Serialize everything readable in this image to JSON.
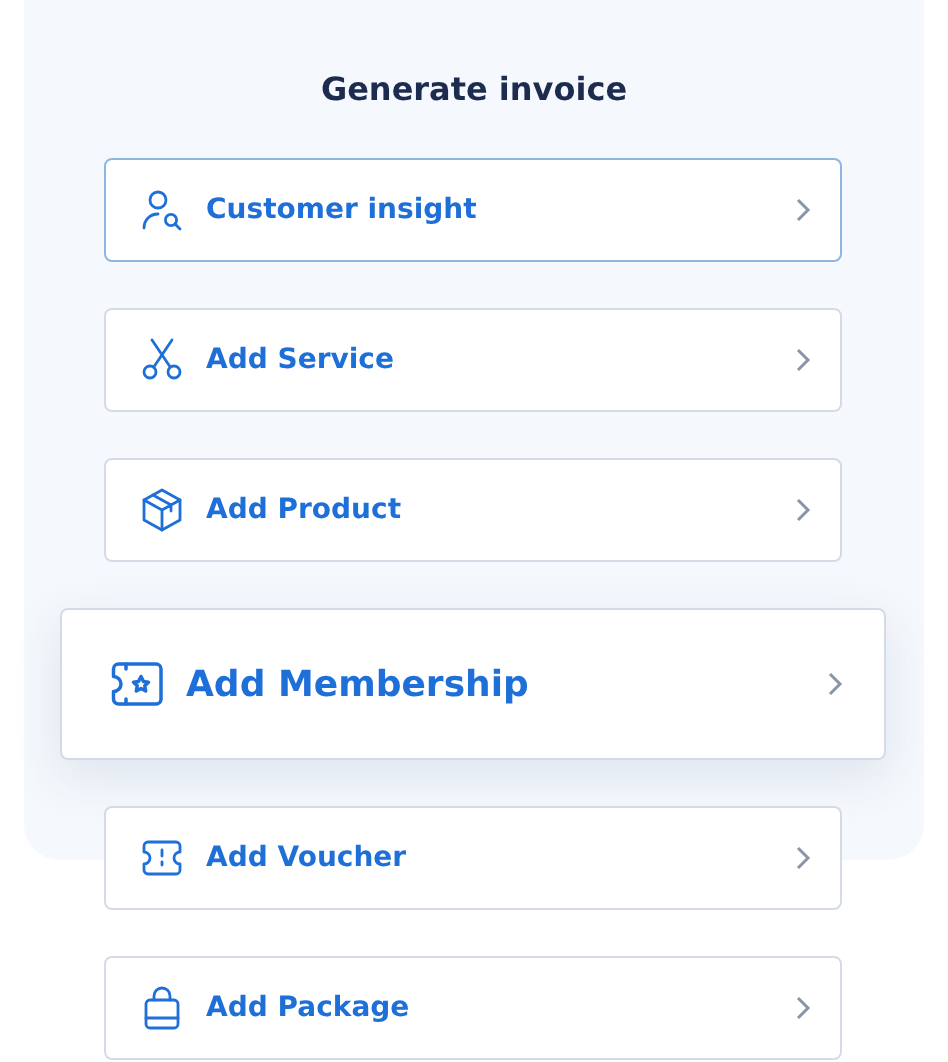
{
  "title": "Generate invoice",
  "items": [
    {
      "label": "Customer insight",
      "kind": "normal",
      "selected": true
    },
    {
      "label": "Add Service",
      "kind": "normal",
      "selected": false
    },
    {
      "label": "Add Product",
      "kind": "normal",
      "selected": false
    },
    {
      "label": "Add Membership",
      "kind": "enlarged",
      "selected": false
    },
    {
      "label": "Add Voucher",
      "kind": "normal",
      "selected": false
    },
    {
      "label": "Add Package",
      "kind": "normal",
      "selected": false
    }
  ]
}
